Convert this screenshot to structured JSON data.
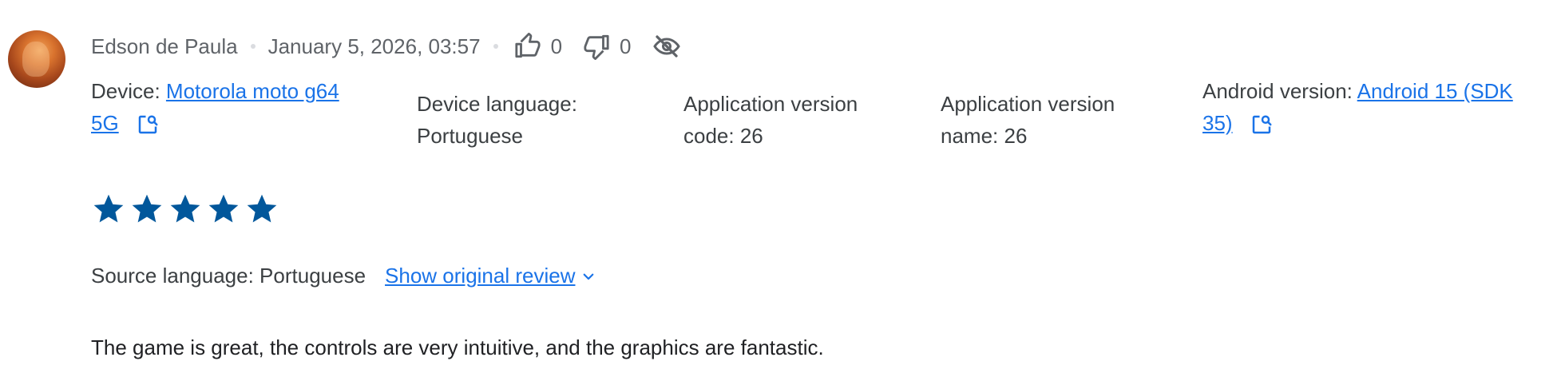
{
  "review": {
    "author": "Edson de Paula",
    "date": "January 5, 2026, 03:57",
    "thumbs_up_count": "0",
    "thumbs_down_count": "0",
    "rating": 5,
    "rating_max": 5,
    "source_language_label": "Source language: Portuguese",
    "show_original_label": "Show original review",
    "text": "The game is great, the controls are very intuitive, and the graphics are fantastic."
  },
  "device": {
    "label": "Device: ",
    "name_line1": "Motorola moto g64",
    "name_line2": "5G"
  },
  "device_language": {
    "line1": "Device language:",
    "line2": "Portuguese"
  },
  "app_version_code": {
    "line1": "Application version",
    "line2": "code: 26"
  },
  "app_version_name": {
    "line1": "Application version",
    "line2": "name: 26"
  },
  "android_version": {
    "label": "Android version: ",
    "value_line1": "Android 15 (SDK",
    "value_line2": "35)"
  },
  "icons": {
    "thumbs_up": "thumbs-up-icon",
    "thumbs_down": "thumbs-down-icon",
    "hide": "eye-off-icon",
    "external": "open-external-icon",
    "chevron": "chevron-down-icon",
    "star": "star-icon"
  },
  "colors": {
    "link": "#1a73e8",
    "star": "#01579b",
    "meta_text": "#5f6368"
  }
}
